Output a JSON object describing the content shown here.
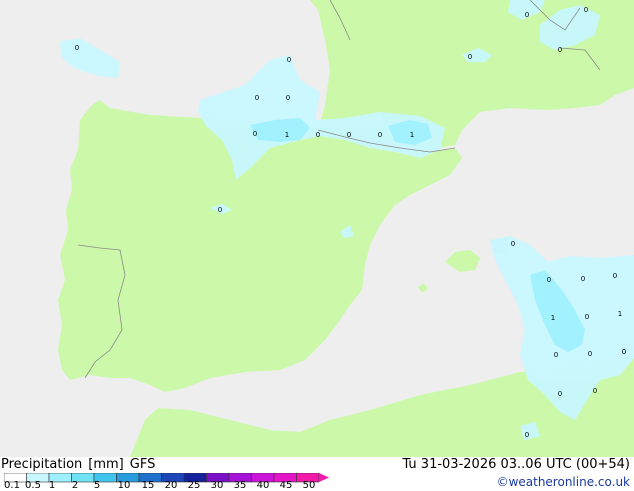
{
  "map": {
    "colors": {
      "sea": "#eeeeee",
      "land": "#ccf9a9",
      "border": "#8a8a8a",
      "precip_light": "#c8f7ff",
      "precip_mid": "#9ff0ff"
    },
    "contour_labels": [
      {
        "text": "0",
        "kind": "value"
      },
      {
        "text": "0",
        "kind": "value"
      },
      {
        "text": "0",
        "kind": "value"
      },
      {
        "text": "0",
        "kind": "value"
      },
      {
        "text": "0",
        "kind": "value"
      },
      {
        "text": "0",
        "kind": "value"
      },
      {
        "text": "1",
        "kind": "value"
      },
      {
        "text": "0",
        "kind": "value"
      },
      {
        "text": "0",
        "kind": "value"
      },
      {
        "text": "0",
        "kind": "value"
      },
      {
        "text": "1",
        "kind": "value"
      },
      {
        "text": "0",
        "kind": "value"
      },
      {
        "text": "0",
        "kind": "value"
      },
      {
        "text": "0",
        "kind": "value"
      },
      {
        "text": "0",
        "kind": "value"
      },
      {
        "text": "0",
        "kind": "value"
      },
      {
        "text": "0",
        "kind": "value"
      },
      {
        "text": "0",
        "kind": "value"
      },
      {
        "text": "1",
        "kind": "value"
      },
      {
        "text": "0",
        "kind": "value"
      },
      {
        "text": "1",
        "kind": "value"
      },
      {
        "text": "0",
        "kind": "value"
      },
      {
        "text": "0",
        "kind": "value"
      },
      {
        "text": "0",
        "kind": "value"
      },
      {
        "text": "0",
        "kind": "value"
      },
      {
        "text": "0",
        "kind": "value"
      },
      {
        "text": "0",
        "kind": "value"
      },
      {
        "text": "0",
        "kind": "value"
      }
    ]
  },
  "footer": {
    "title_parts": [
      "Precipitation",
      "[mm]",
      "GFS"
    ],
    "datetime": "Tu 31-03-2026 03..06 UTC (00+54)",
    "credit": "©weatheronline.co.uk",
    "scale": {
      "labels": [
        "0.1",
        "0.5",
        "1",
        "2",
        "5",
        "10",
        "15",
        "20",
        "25",
        "30",
        "35",
        "40",
        "45",
        "50"
      ],
      "colors": [
        "#ffffff",
        "#c8f7ff",
        "#9ff0ff",
        "#6fe3f5",
        "#3fc5ee",
        "#2a9bdc",
        "#1f6fcc",
        "#1d47b9",
        "#16219e",
        "#7a10c8",
        "#a612d6",
        "#cc14d8",
        "#e516c8",
        "#f21aa8"
      ]
    }
  }
}
